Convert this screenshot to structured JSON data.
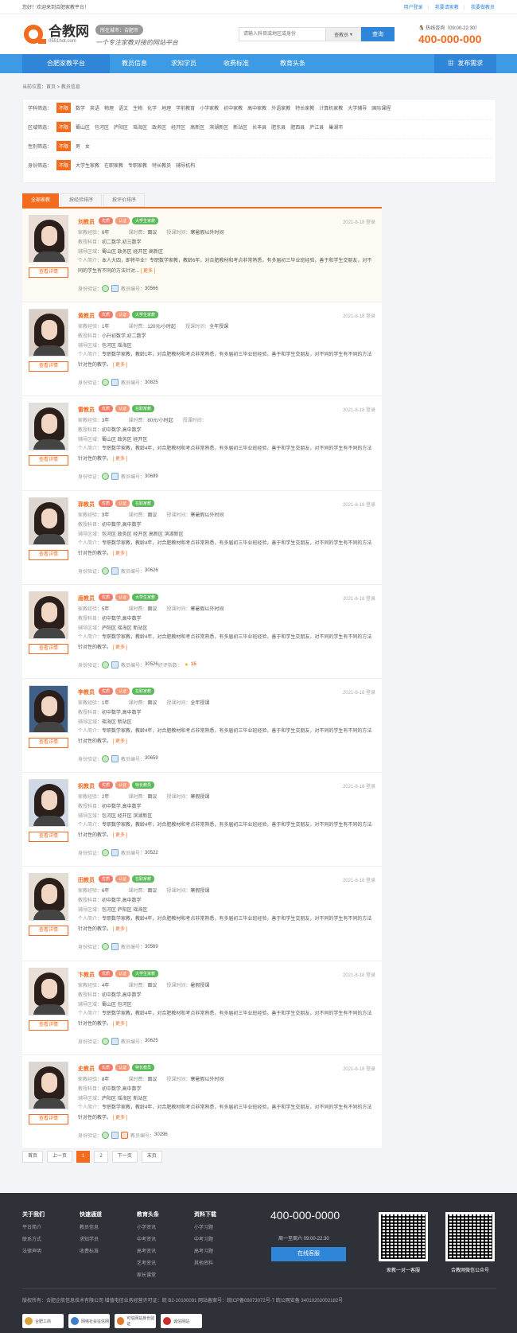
{
  "topbar": {
    "welcome": "您好！欢迎来到合肥家教平台！",
    "links": [
      "用户登录",
      "我要请家教",
      "我要做教员"
    ]
  },
  "header": {
    "logo_cn": "合教网",
    "logo_en": "0551hot.com",
    "city": "所在城市：合肥市",
    "slogan": "一个专注家教对接的网站平台",
    "search_placeholder": "请输入科目或地区或身份",
    "search_type": "查教员",
    "search_button": "查询",
    "hotline_label": "热线咨询（09:00-22:30）",
    "hotline": "400-000-000"
  },
  "nav": {
    "items": [
      "合肥家教平台",
      "教员信息",
      "求知学员",
      "收费标准",
      "教育头条"
    ],
    "publish": "发布需求"
  },
  "breadcrumb": "当前位置：首页 > 教员信息",
  "filters": [
    {
      "label": "学科筛选：",
      "options": [
        "不限",
        "数学",
        "英语",
        "物理",
        "语文",
        "生物",
        "化学",
        "地理",
        "学前教育",
        "小学家教",
        "初中家教",
        "高中家教",
        "外语家教",
        "特长家教",
        "计算机家教",
        "大学辅导",
        "国际课程"
      ]
    },
    {
      "label": "区域筛选：",
      "options": [
        "不限",
        "蜀山区",
        "包河区",
        "庐阳区",
        "瑶海区",
        "政务区",
        "经开区",
        "高新区",
        "滨湖新区",
        "新站区",
        "长丰县",
        "肥东县",
        "肥西县",
        "庐江县",
        "巢湖市"
      ]
    },
    {
      "label": "性别筛选：",
      "options": [
        "不限",
        "男",
        "女"
      ]
    },
    {
      "label": "身份筛选：",
      "options": [
        "不限",
        "大学生家教",
        "在职家教",
        "专职家教",
        "特长教员",
        "辅导机构"
      ]
    }
  ],
  "tabs": [
    "全部家教",
    "按经验排序",
    "按评价排序"
  ],
  "labels": {
    "exp": "家教经验：",
    "time": "课时费：",
    "period": "授课时间：",
    "subject": "教授科目：",
    "area": "辅导区域：",
    "intro": "个人简介：",
    "verify": "身份验证：",
    "no": "教员编号：",
    "more": "[ 更多 ]",
    "detail": "查看详情",
    "praise": "好评指数：",
    "badge1": "优质",
    "badge2": "认证"
  },
  "teachers": [
    {
      "name": "刘教员",
      "type": "大学生家教",
      "date": "2021-8-18 登录",
      "exp": "6年",
      "fee": "面议",
      "period": "寒暑假以外时间",
      "subject": "初二数学,初三数学",
      "area": "蜀山区 政务区 经开区 高新区",
      "intro": "本人大四，即将毕业！专职数学家教，教龄6年，对合肥教材和考点非常熟悉，有多届初三毕业班经验，善于和学生交朋友，对不同的学生有不同的方法针对...",
      "no": "30566",
      "score": ""
    },
    {
      "name": "黄教员",
      "type": "大学生家教",
      "date": "2021-8-18 登录",
      "exp": "1年",
      "fee": "120元/小时起",
      "period": "全年授课",
      "subject": "小升初数学,初二数学",
      "area": "包河区 瑶海区",
      "intro": "专职数学家教，教龄1年，对合肥教材和考点非常熟悉，有多届初三毕业班经验，善于和学生交朋友，对不同的学生有不同的方法针对性的教学。",
      "no": "30825",
      "score": ""
    },
    {
      "name": "雷教员",
      "type": "在职家教",
      "date": "2021-8-18 登录",
      "exp": "3年",
      "fee": "80元/小时起",
      "period": "",
      "subject": "初中数学,高中数学",
      "area": "蜀山区 政务区 经开区",
      "intro": "专职数学家教，教龄4年，对合肥教材和考点非常熟悉，有多届初三毕业班经验，善于和学生交朋友，对不同的学生有不同的方法针对性的教学。",
      "no": "30699",
      "score": ""
    },
    {
      "name": "郭教员",
      "type": "在职家教",
      "date": "2021-8-18 登录",
      "exp": "3年",
      "fee": "面议",
      "period": "寒暑假以外时间",
      "subject": "初中数学,高中数学",
      "area": "包河区 政务区 经开区 高新区 滨湖新区",
      "intro": "专职数学家教，教龄4年，对合肥教材和考点非常熟悉，有多届初三毕业班经验，善于和学生交朋友，对不同的学生有不同的方法针对性的教学。",
      "no": "30626",
      "score": ""
    },
    {
      "name": "唐教员",
      "type": "大学生家教",
      "date": "2021-8-18 登录",
      "exp": "5年",
      "fee": "面议",
      "period": "寒暑假以外时间",
      "subject": "初中数学,高中数学",
      "area": "庐阳区 瑶海区 新站区",
      "intro": "专职数学家教，教龄4年，对合肥教材和考点非常熟悉，有多届初三毕业班经验，善于和学生交朋友，对不同的学生有不同的方法针对性的教学。",
      "no": "30526",
      "score": "15"
    },
    {
      "name": "李教员",
      "type": "在职家教",
      "date": "2021-8-18 登录",
      "exp": "1年",
      "fee": "面议",
      "period": "全年授课",
      "subject": "初中数学,高中数学",
      "area": "瑶海区 新站区",
      "intro": "专职数学家教，教龄4年，对合肥教材和考点非常熟悉，有多届初三毕业班经验，善于和学生交朋友，对不同的学生有不同的方法针对性的教学。",
      "no": "30659",
      "score": ""
    },
    {
      "name": "祝教员",
      "type": "特长教员",
      "date": "2021-8-18 登录",
      "exp": "2年",
      "fee": "面议",
      "period": "寒假授课",
      "subject": "初中数学,高中数学",
      "area": "包河区 经开区 滨湖新区",
      "intro": "专职数学家教，教龄4年，对合肥教材和考点非常熟悉，有多届初三毕业班经验，善于和学生交朋友，对不同的学生有不同的方法针对性的教学。",
      "no": "30522",
      "score": ""
    },
    {
      "name": "田教员",
      "type": "在职家教",
      "date": "2021-8-18 登录",
      "exp": "6年",
      "fee": "面议",
      "period": "寒假授课",
      "subject": "初中数学,高中数学",
      "area": "包河区 庐阳区 瑶海区",
      "intro": "专职数学家教，教龄4年，对合肥教材和考点非常熟悉，有多届初三毕业班经验，善于和学生交朋友，对不同的学生有不同的方法针对性的教学。",
      "no": "30569",
      "score": ""
    },
    {
      "name": "卞教员",
      "type": "大学生家教",
      "date": "2021-8-18 登录",
      "exp": "4年",
      "fee": "面议",
      "period": "暑假授课",
      "subject": "初中数学,高中数学",
      "area": "蜀山区 包河区",
      "intro": "专职数学家教，教龄4年，对合肥教材和考点非常熟悉，有多届初三毕业班经验，善于和学生交朋友，对不同的学生有不同的方法针对性的教学。",
      "no": "30625",
      "score": ""
    },
    {
      "name": "史教员",
      "type": "特长教员",
      "date": "2021-8-18 登录",
      "exp": "8年",
      "fee": "面议",
      "period": "寒暑假以外时间",
      "subject": "初中数学,高中数学",
      "area": "庐阳区 瑶海区 新站区",
      "intro": "专职数学家教，教龄4年，对合肥教材和考点非常熟悉，有多届初三毕业班经验，善于和学生交朋友，对不同的学生有不同的方法针对性的教学。",
      "no": "30296",
      "score": ""
    }
  ],
  "pager": [
    "首页",
    "上一页",
    "1",
    "2",
    "下一页",
    "末页"
  ],
  "footer": {
    "cols": [
      {
        "title": "关于我们",
        "items": [
          "平台简介",
          "联系方式",
          "法律声明"
        ]
      },
      {
        "title": "快速通道",
        "items": [
          "教员信息",
          "求知学员",
          "收费标准"
        ]
      },
      {
        "title": "教育头条",
        "items": [
          "小学资讯",
          "中考资讯",
          "高考资讯",
          "艺考资讯",
          "家长课堂"
        ]
      },
      {
        "title": "资料下载",
        "items": [
          "小学习题",
          "中考习题",
          "高考习题",
          "其他资料"
        ]
      }
    ],
    "phone": "400-000-0000",
    "hours": "周一至周六 09:00-22:30",
    "service": "在线客服",
    "qr1": "家教一对一客服",
    "qr2": "合教网微信公众号",
    "copyright": "版权所有：合肥企航信息技术有限公司 增值电信业务经营许可证：皖 B2-20100091 网站备案号：皖ICP备09073072号-7 皖公网安备 34010202002182号",
    "seals": [
      "合肥工商",
      "网络社会征信网",
      "可信网站身份验证",
      "诚信网站"
    ]
  }
}
